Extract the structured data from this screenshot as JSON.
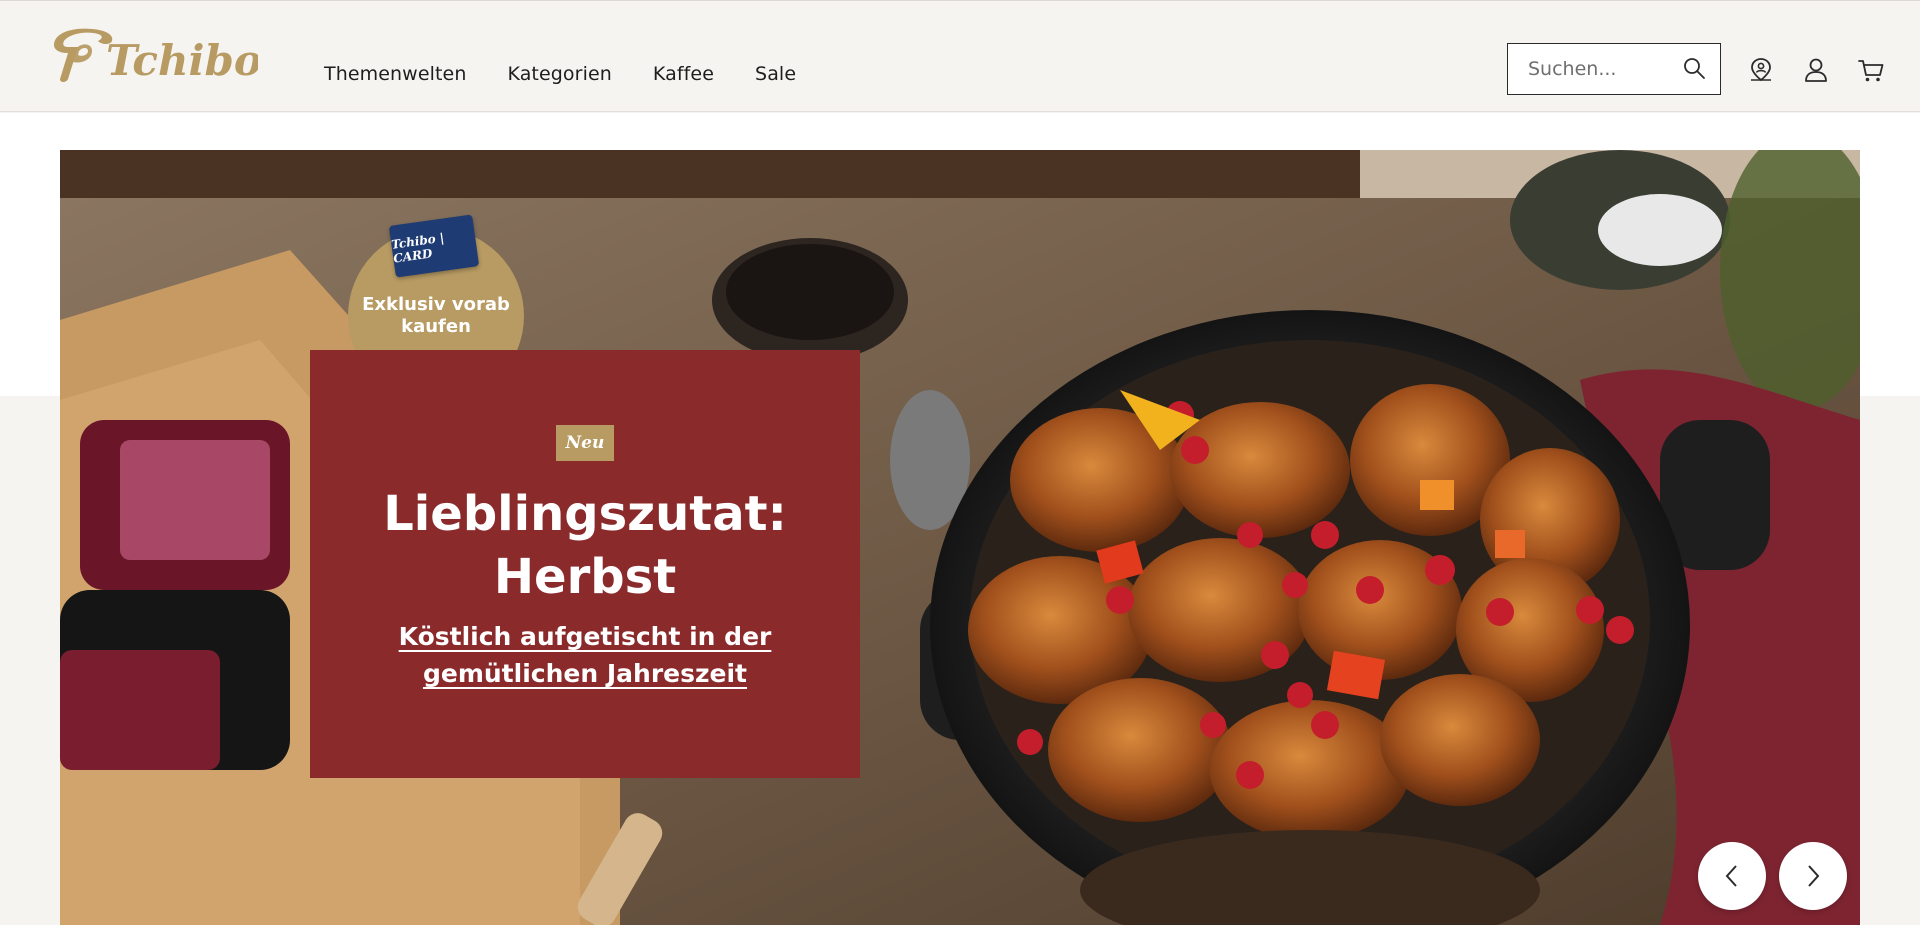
{
  "brand": {
    "logo_text": "Tchibo"
  },
  "nav": {
    "items": [
      {
        "label": "Themenwelten"
      },
      {
        "label": "Kategorien"
      },
      {
        "label": "Kaffee"
      },
      {
        "label": "Sale"
      }
    ]
  },
  "search": {
    "placeholder": "Suchen...",
    "value": ""
  },
  "header_icons": [
    "store-locator-icon",
    "account-icon",
    "cart-icon"
  ],
  "hero": {
    "card_chip": "Tchibo | CARD",
    "badge": "Exklusiv vorab kaufen",
    "new_tag": "Neu",
    "title": "Lieblingszutat: Herbst",
    "subtitle": "Köstlich aufgetischt in der gemütlichen Jahreszeit"
  },
  "colors": {
    "brand_gold": "#b89b63",
    "promo_red": "#8a2a2b",
    "page_bg": "#f6f4f1"
  }
}
